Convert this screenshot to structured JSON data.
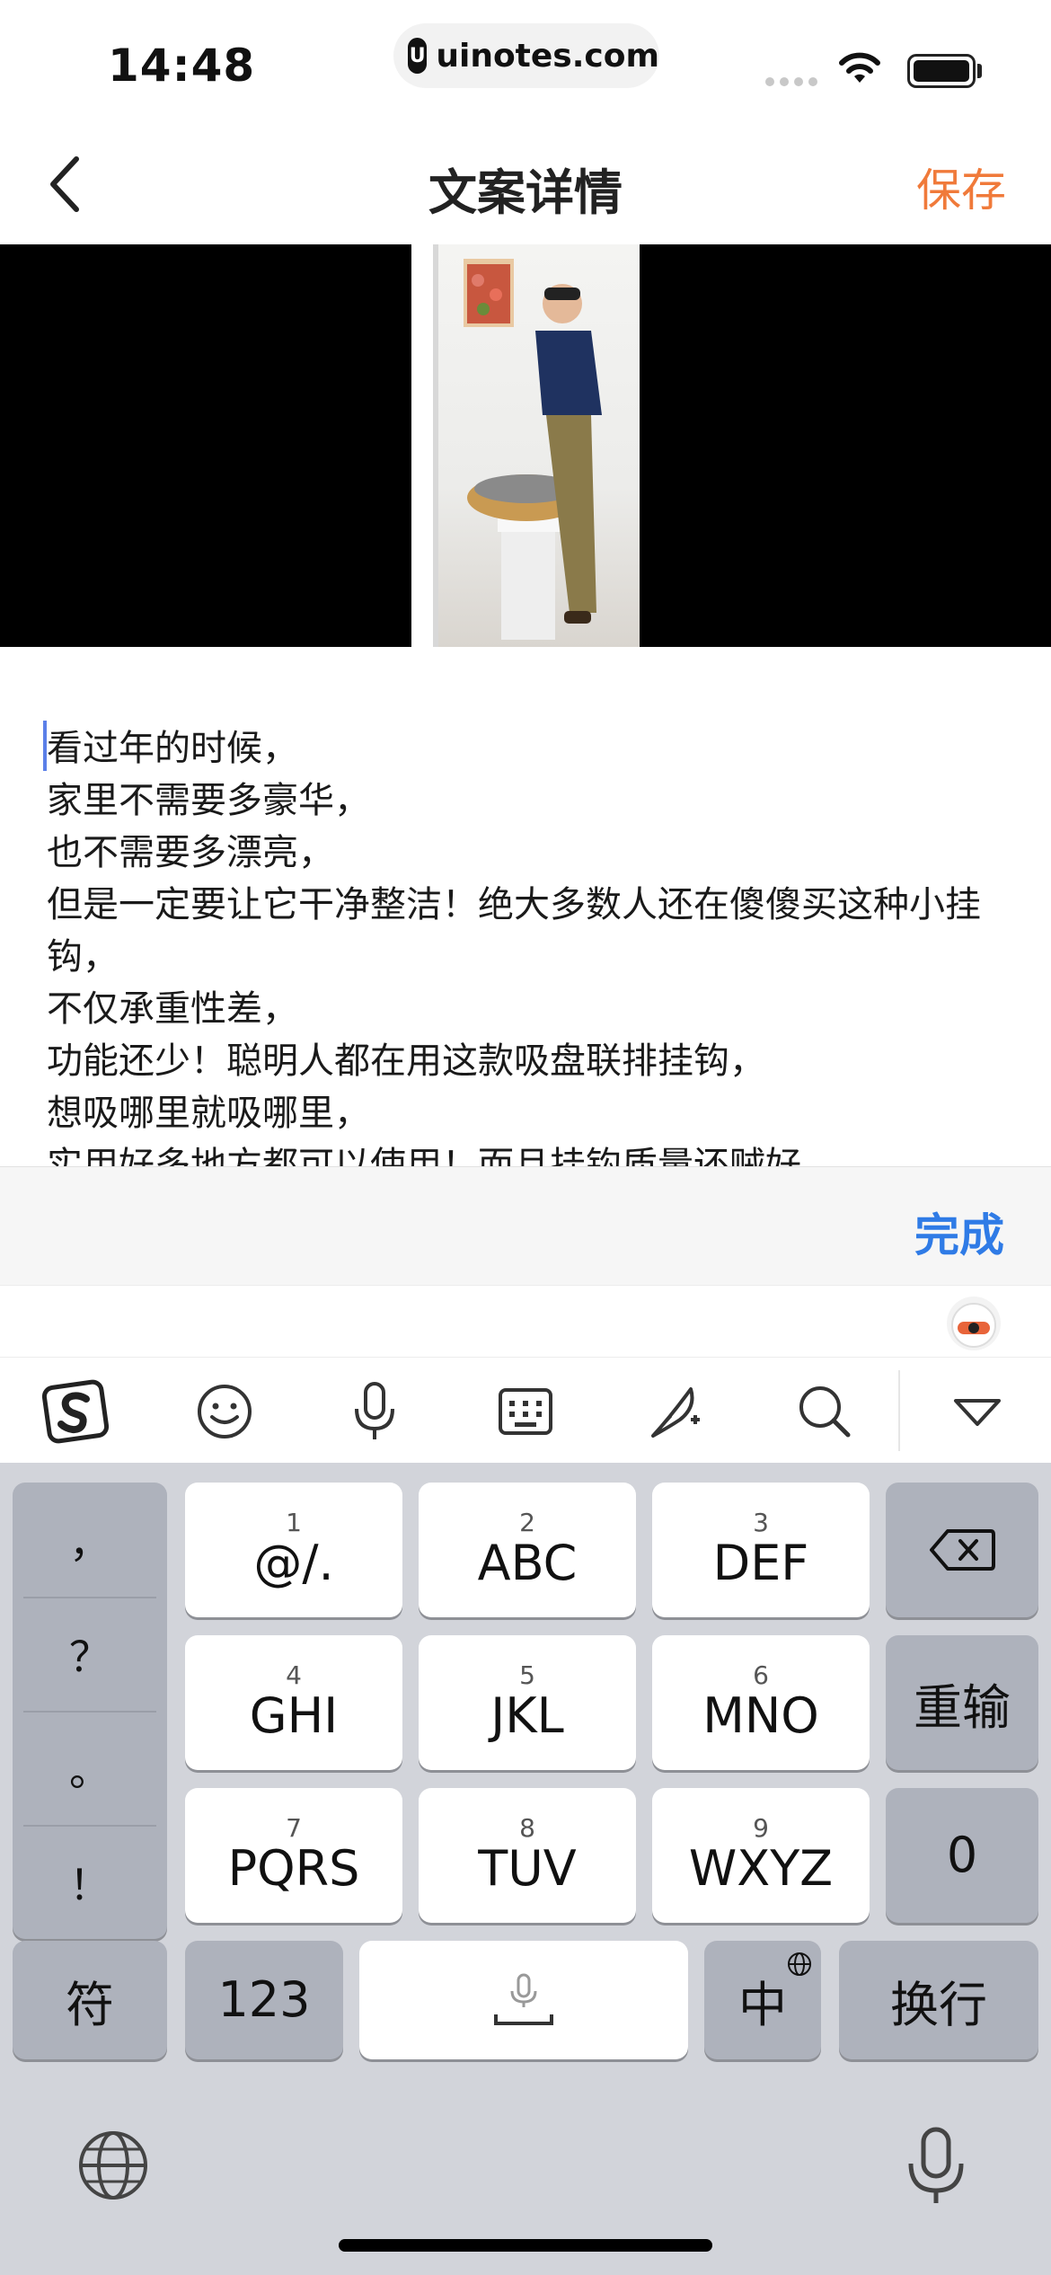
{
  "status_bar": {
    "time": "14:48",
    "url": "uinotes.com",
    "url_logo": "U"
  },
  "nav": {
    "title": "文案详情",
    "save": "保存"
  },
  "text": {
    "lines": [
      "看过年的时候，",
      "家里不需要多豪华，",
      "也不需要多漂亮，",
      "但是一定要让它干净整洁！绝大多数人还在傻傻买这种小挂钩，",
      "不仅承重性差，",
      "功能还少！聪明人都在用这款吸盘联排挂钩，",
      "想吸哪里就吸哪里，",
      "实用好多地方都可以使用！而且挂钩质量还贼好"
    ]
  },
  "accessory": {
    "done": "完成"
  },
  "keyboard": {
    "punctuation": [
      "，",
      "？",
      "。",
      "！"
    ],
    "keys": [
      {
        "num": "1",
        "label": "@/."
      },
      {
        "num": "2",
        "label": "ABC"
      },
      {
        "num": "3",
        "label": "DEF"
      },
      {
        "num": "4",
        "label": "GHI"
      },
      {
        "num": "5",
        "label": "JKL"
      },
      {
        "num": "6",
        "label": "MNO"
      },
      {
        "num": "7",
        "label": "PQRS"
      },
      {
        "num": "8",
        "label": "TUV"
      },
      {
        "num": "9",
        "label": "WXYZ"
      }
    ],
    "reinput": "重输",
    "zero": "0",
    "symbols": "符",
    "numbers": "123",
    "lang": "中",
    "return": "换行"
  },
  "colors": {
    "accent_save": "#f07a3a",
    "accent_done": "#2f7be6",
    "keyboard_bg": "#d2d4da"
  }
}
